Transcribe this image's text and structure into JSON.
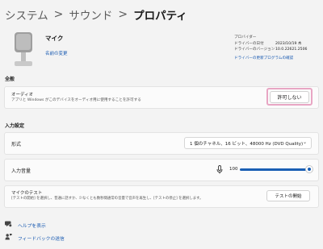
{
  "breadcrumb": {
    "items": [
      "システム",
      "サウンド"
    ],
    "current": "プロパティ",
    "separator": ">"
  },
  "device": {
    "name": "マイク",
    "rename_link": "名前の変更",
    "icon": "microphone-icon"
  },
  "properties": {
    "rows": [
      {
        "label": "プロバイダー",
        "value": ""
      },
      {
        "label": "ドライバーの日付",
        "value": "2023/10/19 木"
      },
      {
        "label": "ドライバーのバージョン",
        "value": "10.0.22621.2506"
      }
    ],
    "driver_update_link": "ドライバーの更新プログラムの確認"
  },
  "general": {
    "section_title": "全般",
    "audio": {
      "title": "オーディオ",
      "description": "アプリと Windows がこのデバイスをオーディオ用に使用することを許可する",
      "button_label": "許可しない"
    }
  },
  "input_settings": {
    "section_title": "入力設定",
    "format": {
      "label": "形式",
      "selected": "1 個のチャネル、16 ビット、48000 Hz (DVD Quality)"
    },
    "volume": {
      "label": "入力音量",
      "value": "100",
      "level_percent": 100
    },
    "mic_test": {
      "title": "マイクのテスト",
      "description": "[テストの開始] を選択し、普通に話すか、少なくとも数秒間通常の音量で音声を再生し、[テストの停止] を選択します。",
      "button_label": "テストの開始"
    }
  },
  "footer": {
    "help": "ヘルプを表示",
    "feedback": "フィードバックの送信"
  },
  "colors": {
    "accent": "#1a5fb4",
    "link": "#1557b0",
    "highlight": "#e8a6c4",
    "background": "#f3f3f3",
    "card": "#fbfbfb"
  }
}
